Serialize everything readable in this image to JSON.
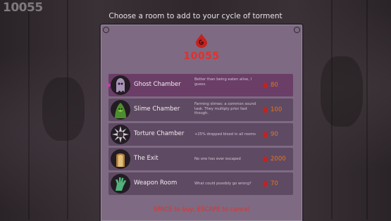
{
  "hud": {
    "score": "10055"
  },
  "instruction": "Choose a room to add to your cycle of torment",
  "panel": {
    "currency_total": "10055",
    "currency_icon": "blood-swirl-icon",
    "rooms": [
      {
        "name": "Ghost Chamber",
        "description": "Better than being eaten alive, I guess.",
        "cost": "80",
        "icon": "ghost-icon",
        "selected": true
      },
      {
        "name": "Slime Chamber",
        "description": "Farming slimes: a common sound task. They multiply prior fast though.",
        "cost": "100",
        "icon": "slime-icon",
        "selected": false
      },
      {
        "name": "Torture Chamber",
        "description": "+25% dropped blood in all rooms",
        "cost": "90",
        "icon": "spiked-wheel-icon",
        "selected": false
      },
      {
        "name": "The Exit",
        "description": "No one has ever escaped",
        "cost": "2000",
        "icon": "door-icon",
        "selected": false
      },
      {
        "name": "Weapon Room",
        "description": "What could possibly go wrong?",
        "cost": "70",
        "icon": "green-hand-icon",
        "selected": false
      }
    ],
    "footer": "SPACE to buy, ESCAPE to cancel"
  },
  "colors": {
    "blood_red": "#e0312d",
    "cost_orange": "#e3751f",
    "panel": "#7e6a82",
    "row": "#5f4a63",
    "row_selected": "#6a3e67"
  }
}
